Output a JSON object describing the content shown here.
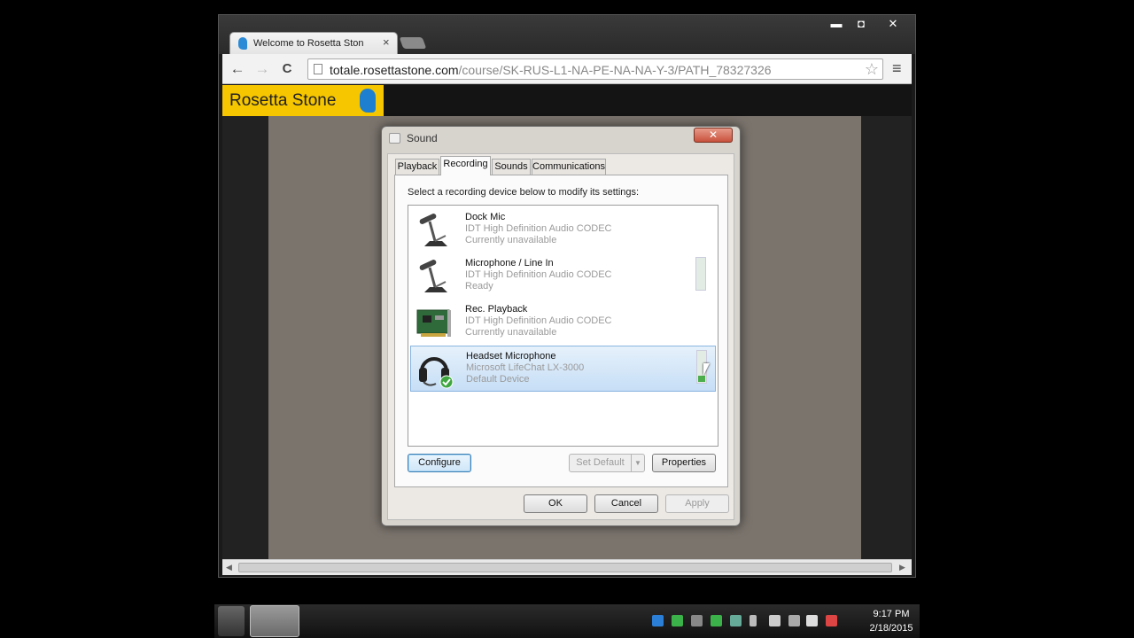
{
  "browser": {
    "tab_title": "Welcome to Rosetta Ston",
    "tab_close": "×",
    "window_buttons": {
      "minimize": "▬",
      "maximize": "◘",
      "close": "✕"
    },
    "nav": {
      "back": "←",
      "forward": "→",
      "reload": "C"
    },
    "url_host": "totale.rosettastone.com",
    "url_path": "/course/SK-RUS-L1-NA-PE-NA-NA-Y-3/PATH_78327326",
    "star": "☆",
    "menu": "≡"
  },
  "site": {
    "logo_text": "Rosetta Stone"
  },
  "dialog": {
    "title": "Sound",
    "close": "✕",
    "tabs": [
      "Playback",
      "Recording",
      "Sounds",
      "Communications"
    ],
    "active_tab": "Recording",
    "instruction": "Select a recording device below to modify its settings:",
    "devices": [
      {
        "name": "Dock Mic",
        "driver": "IDT High Definition Audio CODEC",
        "status": "Currently unavailable",
        "icon": "microphone-stand-icon",
        "selected": false,
        "level": null
      },
      {
        "name": "Microphone / Line In",
        "driver": "IDT High Definition Audio CODEC",
        "status": "Ready",
        "icon": "microphone-stand-icon",
        "selected": false,
        "level": 0
      },
      {
        "name": "Rec. Playback",
        "driver": "IDT High Definition Audio CODEC",
        "status": "Currently unavailable",
        "icon": "sound-card-icon",
        "selected": false,
        "level": null
      },
      {
        "name": "Headset Microphone",
        "driver": "Microsoft LifeChat LX-3000",
        "status": "Default Device",
        "icon": "headset-icon",
        "selected": true,
        "level": 0.2
      }
    ],
    "buttons": {
      "configure": "Configure",
      "set_default": "Set Default",
      "properties": "Properties",
      "ok": "OK",
      "cancel": "Cancel",
      "apply": "Apply"
    }
  },
  "taskbar": {
    "clock_time": "9:17 PM",
    "clock_date": "2/18/2015"
  },
  "colors": {
    "rosetta_yellow": "#f6c600",
    "selection_blue": "#c6def6",
    "level_green": "#4cae4c"
  }
}
